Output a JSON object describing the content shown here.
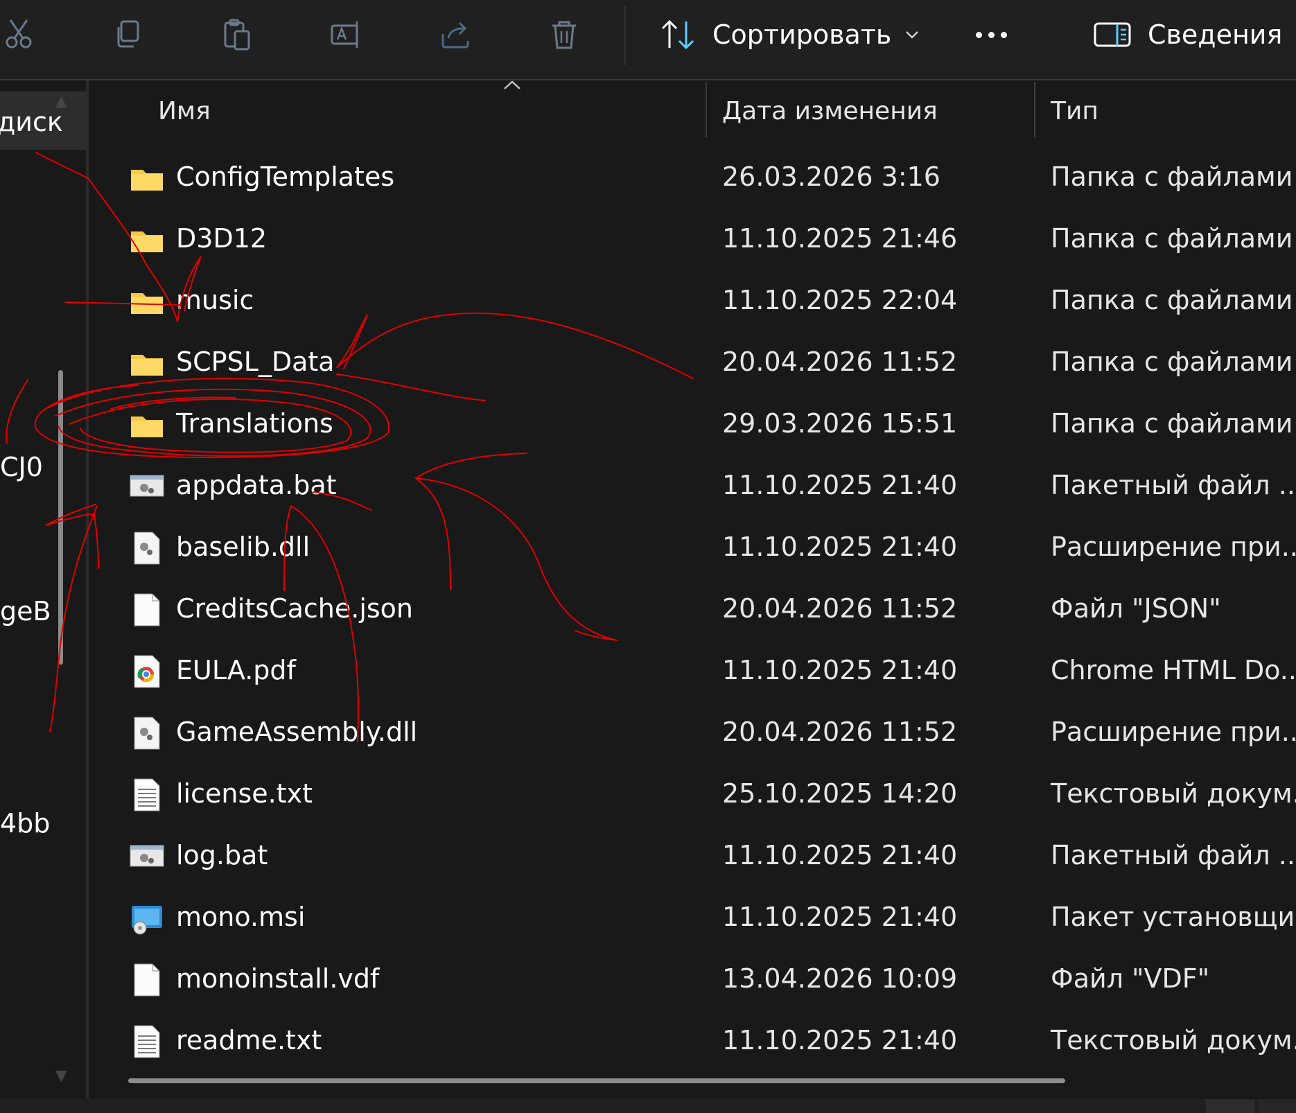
{
  "toolbar": {
    "buttons": [
      {
        "icon": "cut-icon"
      },
      {
        "icon": "copy-icon"
      },
      {
        "icon": "paste-icon"
      },
      {
        "icon": "rename-icon"
      },
      {
        "icon": "share-icon"
      },
      {
        "icon": "delete-icon"
      }
    ],
    "sort_label": "Сортировать",
    "details_label": "Сведения"
  },
  "navpane": {
    "items": [
      "диск",
      "CJ0",
      "geB",
      "4bb"
    ]
  },
  "columns": {
    "name": "Имя",
    "date": "Дата изменения",
    "type": "Тип"
  },
  "files": [
    {
      "name": "ConfigTemplates",
      "date": "26.03.2026 3:16",
      "type": "Папка с файлами",
      "icon": "folder-icon"
    },
    {
      "name": "D3D12",
      "date": "11.10.2025 21:46",
      "type": "Папка с файлами",
      "icon": "folder-icon"
    },
    {
      "name": "music",
      "date": "11.10.2025 22:04",
      "type": "Папка с файлами",
      "icon": "folder-icon"
    },
    {
      "name": "SCPSL_Data",
      "date": "20.04.2026 11:52",
      "type": "Папка с файлами",
      "icon": "folder-icon"
    },
    {
      "name": "Translations",
      "date": "29.03.2026 15:51",
      "type": "Папка с файлами",
      "icon": "folder-icon"
    },
    {
      "name": "appdata.bat",
      "date": "11.10.2025 21:40",
      "type": "Пакетный файл ...",
      "icon": "batch-file-icon"
    },
    {
      "name": "baselib.dll",
      "date": "11.10.2025 21:40",
      "type": "Расширение при...",
      "icon": "dll-file-icon"
    },
    {
      "name": "CreditsCache.json",
      "date": "20.04.2026 11:52",
      "type": "Файл \"JSON\"",
      "icon": "blank-file-icon"
    },
    {
      "name": "EULA.pdf",
      "date": "11.10.2025 21:40",
      "type": "Chrome HTML Do...",
      "icon": "chrome-pdf-icon"
    },
    {
      "name": "GameAssembly.dll",
      "date": "20.04.2026 11:52",
      "type": "Расширение при...",
      "icon": "dll-file-icon"
    },
    {
      "name": "license.txt",
      "date": "25.10.2025 14:20",
      "type": "Текстовый докум...",
      "icon": "text-file-icon"
    },
    {
      "name": "log.bat",
      "date": "11.10.2025 21:40",
      "type": "Пакетный файл ...",
      "icon": "batch-file-icon"
    },
    {
      "name": "mono.msi",
      "date": "11.10.2025 21:40",
      "type": "Пакет установщи...",
      "icon": "installer-icon"
    },
    {
      "name": "monoinstall.vdf",
      "date": "13.04.2026 10:09",
      "type": "Файл \"VDF\"",
      "icon": "blank-file-icon"
    },
    {
      "name": "readme.txt",
      "date": "11.10.2025 21:40",
      "type": "Текстовый докум...",
      "icon": "text-file-icon"
    }
  ],
  "colors": {
    "background": "#191919",
    "toolbar": "#202020",
    "folder": "#f8c846",
    "accent": "#60cdff",
    "annotation": "#e00000"
  }
}
